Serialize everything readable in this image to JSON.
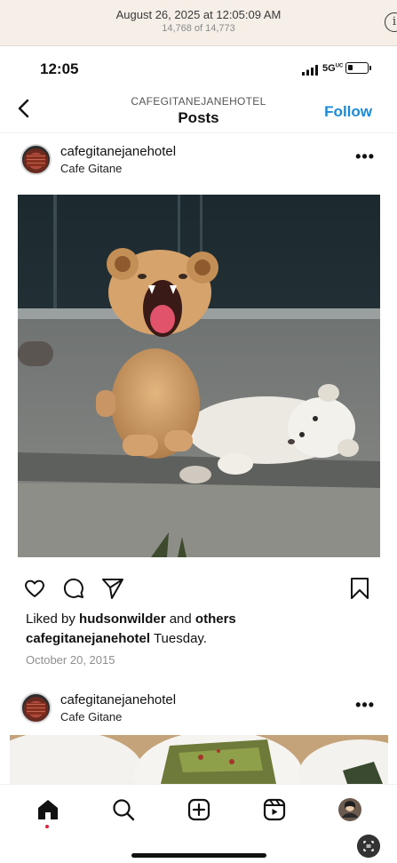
{
  "viewer": {
    "date": "August 26, 2025 at 12:05:09 AM",
    "count": "14,768 of 14,773",
    "info_label": "i"
  },
  "status_bar": {
    "time": "12:05",
    "network": "5G",
    "network_sup": "UC",
    "battery_level": 0.25
  },
  "nav": {
    "username": "CAFEGITANEJANEHOTEL",
    "title": "Posts",
    "follow_label": "Follow"
  },
  "post": {
    "username": "cafegitanejanehotel",
    "location": "Cafe Gitane",
    "more_label": "•••",
    "likes_prefix": "Liked by ",
    "likes_user": "hudsonwilder",
    "likes_middle": " and ",
    "likes_others": "others",
    "caption_user": "cafegitanejanehotel",
    "caption_text": " Tuesday.",
    "date": "October 20, 2015"
  },
  "post2": {
    "username": "cafegitanejanehotel",
    "location": "Cafe Gitane",
    "more_label": "•••"
  },
  "icons": {
    "back": "chevron-left-icon",
    "like": "heart-icon",
    "comment": "comment-icon",
    "share": "send-icon",
    "save": "bookmark-icon",
    "home": "home-icon",
    "search": "search-icon",
    "create": "plus-square-icon",
    "reels": "reels-icon"
  },
  "colors": {
    "follow": "#1b8ad8",
    "notification_dot": "#e0243a"
  }
}
